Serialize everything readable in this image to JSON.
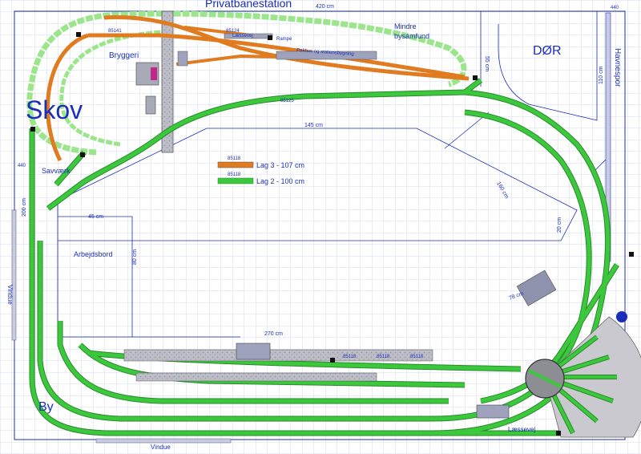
{
  "title": "Privatbanestation",
  "labels": {
    "door": "DØR",
    "forest": "Skov",
    "brewery": "Bryggeri",
    "town": "By",
    "small_town_line1": "Mindre",
    "small_town_line2": "bysamfund",
    "sawmill": "Savværk",
    "harbor_track": "Havnespor",
    "workbench": "Arbejdsbord",
    "window_left": "Vindue",
    "window_bottom": "Vindue",
    "loading_track_top": "Læssevej",
    "loading_track_bottom": "Læssevej",
    "ramp": "Rampe",
    "freight_house": "Pakhus og stationsbygning"
  },
  "legend": [
    {
      "code": "85118",
      "label": "Lag 3 - 107 cm",
      "color": "#e07b1f"
    },
    {
      "code": "85118",
      "label": "Lag 2 - 100 cm",
      "color": "#3cc83c"
    }
  ],
  "dimensions": {
    "top_width": "420 cm",
    "inner_width": "145 cm",
    "bench_width": "270 cm",
    "left_height": "200 cm",
    "bench_height": "80 cm",
    "right_depth": "110 cm",
    "diagonal_a": "160 cm",
    "diagonal_b": "20 cm",
    "door_depth": "55 cm",
    "corner_a": "78 cm",
    "bench_top": "45 cm"
  },
  "markers": {
    "corner_top_right": "440",
    "corner_left": "440"
  },
  "track_codes": [
    "85118",
    "85118",
    "85118",
    "85125",
    "85141",
    "85124"
  ],
  "colors": {
    "layer3": "#e07b1f",
    "layer2": "#3cc83c",
    "forest": "#9be58a",
    "grid": "#d6d9ec",
    "label": "#1a2fb8"
  }
}
